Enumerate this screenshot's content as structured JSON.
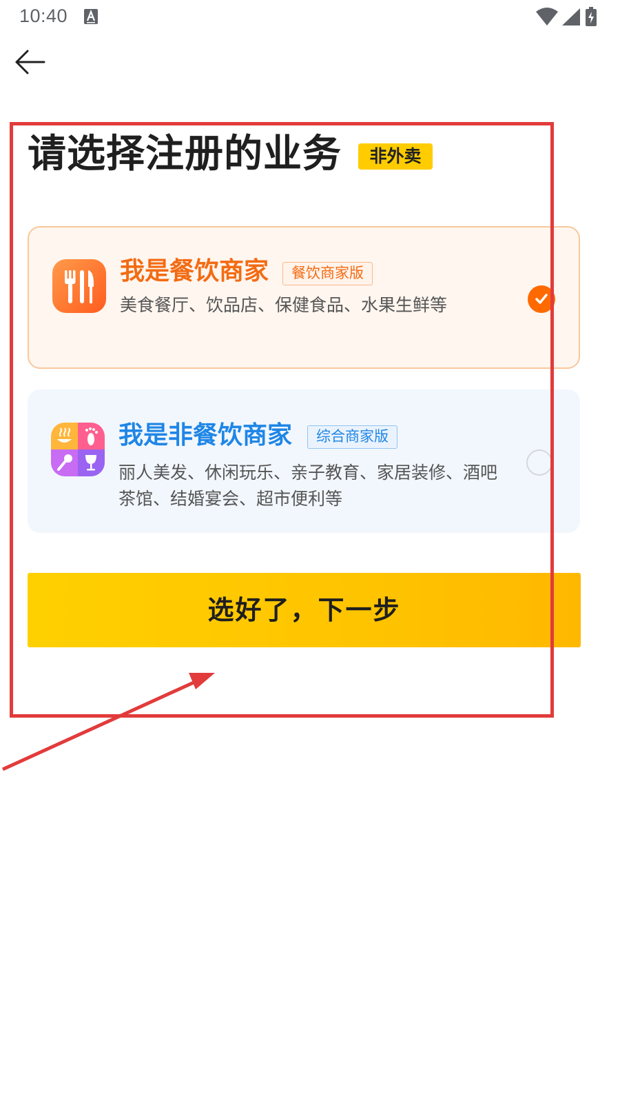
{
  "status_bar": {
    "time": "10:40",
    "notification_icon": "text-a-icon",
    "wifi_icon": "wifi-icon",
    "signal_icon": "cell-signal-icon",
    "battery_icon": "battery-charging-icon"
  },
  "nav": {
    "back_icon": "arrow-left-icon"
  },
  "header": {
    "title": "请选择注册的业务",
    "badge": "非外卖"
  },
  "options": [
    {
      "title": "我是餐饮商家",
      "tag": "餐饮商家版",
      "description": "美食餐厅、饮品店、保健食品、水果生鲜等",
      "icon": "fork-knife-icon",
      "selected": true
    },
    {
      "title": "我是非餐饮商家",
      "tag": "综合商家版",
      "description": "丽人美发、休闲玩乐、亲子教育、家居装修、酒吧茶馆、结婚宴会、超市便利等",
      "icon": "multi-service-icon",
      "selected": false
    }
  ],
  "actions": {
    "next_label": "选好了，下一步"
  },
  "colors": {
    "accent_yellow": "#ffcc00",
    "catering_orange": "#f36b13",
    "noncatering_blue": "#1f86e6",
    "annotation_red": "#e23b3b"
  }
}
